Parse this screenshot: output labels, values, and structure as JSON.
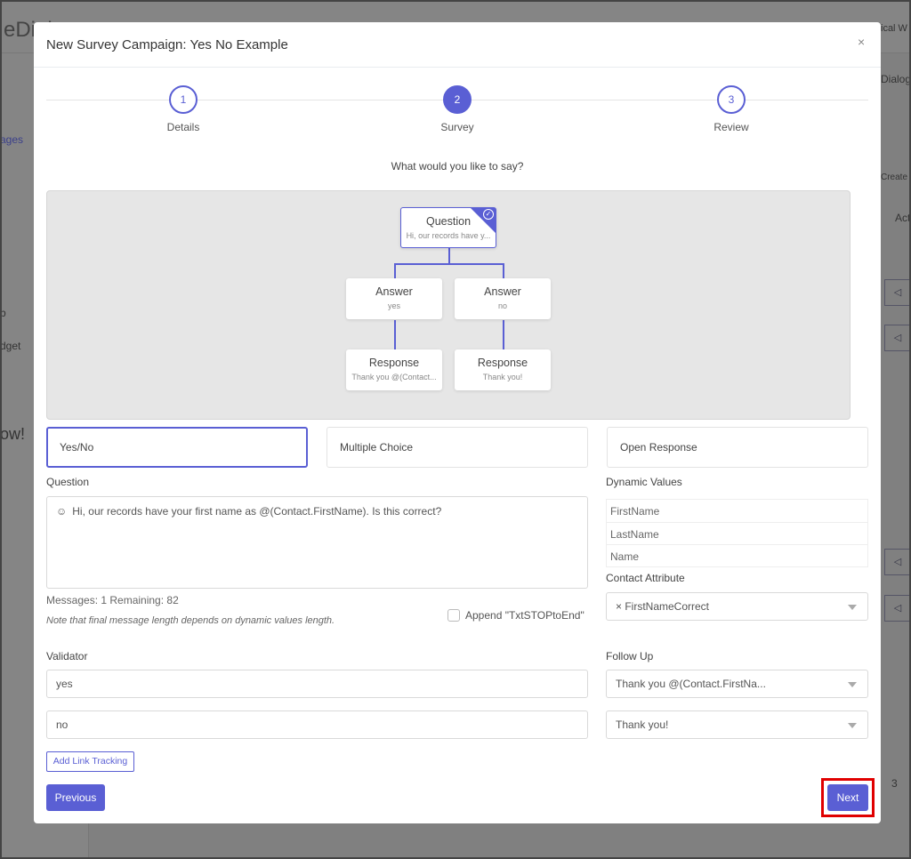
{
  "background": {
    "brand_fragment": "eDial",
    "nav_fragments": [
      "ages",
      "b",
      "dget",
      "ow!"
    ],
    "user_fragment": "ical W",
    "dialog_fragment": "Dialog",
    "create_fragment": "Create",
    "act_fragment": "Act",
    "page_fragment": "3"
  },
  "modal": {
    "title": "New Survey Campaign: Yes No Example",
    "close_label": "×",
    "steps": [
      {
        "number": "1",
        "label": "Details"
      },
      {
        "number": "2",
        "label": "Survey"
      },
      {
        "number": "3",
        "label": "Review"
      }
    ],
    "active_step": 2,
    "prompt": "What would you like to say?",
    "flow": {
      "question": {
        "title": "Question",
        "text": "Hi, our records have y..."
      },
      "answers": [
        {
          "title": "Answer",
          "text": "yes"
        },
        {
          "title": "Answer",
          "text": "no"
        }
      ],
      "responses": [
        {
          "title": "Response",
          "text": "Thank you @(Contact..."
        },
        {
          "title": "Response",
          "text": "Thank you!"
        }
      ]
    },
    "types": [
      {
        "label": "Yes/No",
        "active": true
      },
      {
        "label": "Multiple Choice"
      },
      {
        "label": "Open Response"
      }
    ],
    "question_label": "Question",
    "question_value": "Hi, our records have your first name as @(Contact.FirstName). Is this correct?",
    "messages_info": "Messages: 1 Remaining: 82",
    "note": "Note that final message length depends on dynamic values length.",
    "append_label": "Append \"TxtSTOPtoEnd\"",
    "append_checked": false,
    "dynamic_values_label": "Dynamic Values",
    "dynamic_values": [
      "FirstName",
      "LastName",
      "Name"
    ],
    "contact_attribute_label": "Contact Attribute",
    "contact_attribute_value": "× FirstNameCorrect",
    "validator_label": "Validator",
    "validators": [
      "yes",
      "no"
    ],
    "follow_up_label": "Follow Up",
    "follow_ups": [
      "Thank you @(Contact.FirstNa...",
      "Thank you!"
    ],
    "add_link_tracking": "Add Link Tracking",
    "previous": "Previous",
    "next": "Next",
    "accent": "#5a5fd4",
    "highlight_color": "#e00000"
  }
}
